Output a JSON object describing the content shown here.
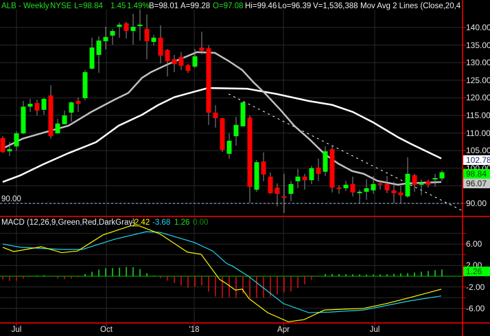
{
  "header": {
    "symbol": "ALB - Weekly",
    "exchange": "NYSE",
    "last": "L=98.84",
    "change": "1.45",
    "change_pct": "1.49%",
    "bid": "B=98.01",
    "ask": "A=99.28",
    "open": "O=97.08",
    "high": "Hi=99.46",
    "low": "Lo=96.39",
    "volume": "V=1,536,388",
    "study": "Mov Avg 2 Lines (Close,20,4 ..."
  },
  "macd_header": {
    "label": "MACD (12,26,9,Green,Red,DarkGray)",
    "macd": "-2.42",
    "signal": "-3.68",
    "histogram": "1.26",
    "zero": "0.00"
  },
  "price_axis": [
    "140.00",
    "135.00",
    "130.00",
    "125.00",
    "120.00",
    "115.00",
    "110.00",
    "105.00",
    "100.00",
    "90.00"
  ],
  "price_tags": {
    "ma40": "102.78",
    "last": "98.84",
    "ma20": "96.07"
  },
  "support_label": "90.00",
  "macd_axis": [
    "6.00",
    "2.00",
    "-2.00",
    "-6.00"
  ],
  "macd_tag": "1.26",
  "x_labels": [
    "Jul",
    "Oct",
    "'18",
    "Apr",
    "Jul"
  ],
  "colors": {
    "up": "#00ff00",
    "down": "#ff0000",
    "ma20": "#c0c0c0",
    "ma40": "#ffffff",
    "macd": "#ffff00",
    "signal": "#20d8f0",
    "axis": "#ff0000",
    "grid": "#2a2a2a",
    "support": "#9ec9ff"
  },
  "chart_data": {
    "type": "candlestick",
    "title": "ALB - Weekly",
    "ylim": [
      85,
      145
    ],
    "x_tick_labels": [
      {
        "label": "Jul",
        "index": 2
      },
      {
        "label": "Oct",
        "index": 15.1
      },
      {
        "label": "'18",
        "index": 27.9
      },
      {
        "label": "Apr",
        "index": 40.9
      },
      {
        "label": "Jul",
        "index": 54.2
      }
    ],
    "candles_ohlc": [
      [
        108.6,
        109.1,
        104.3,
        104.6
      ],
      [
        104.8,
        107.4,
        103.5,
        105.4
      ],
      [
        106.2,
        110.5,
        105.0,
        109.9
      ],
      [
        109.9,
        119.1,
        109.7,
        117.5
      ],
      [
        117.5,
        119.7,
        116.0,
        118.3
      ],
      [
        118.5,
        119.5,
        115.0,
        116.4
      ],
      [
        116.6,
        120.1,
        115.2,
        119.7
      ],
      [
        120.7,
        123.6,
        108.4,
        109.1
      ],
      [
        109.9,
        114.0,
        109.9,
        112.7
      ],
      [
        112.5,
        116.4,
        112.5,
        115.0
      ],
      [
        115.8,
        118.9,
        113.2,
        118.7
      ],
      [
        119.1,
        120.1,
        116.0,
        118.3
      ],
      [
        119.9,
        127.9,
        119.3,
        127.3
      ],
      [
        128.3,
        137.1,
        128.1,
        134.3
      ],
      [
        132.2,
        137.5,
        127.1,
        136.3
      ],
      [
        136.1,
        140.2,
        133.8,
        137.3
      ],
      [
        137.7,
        139.6,
        135.1,
        139.0
      ],
      [
        140.2,
        141.4,
        137.1,
        140.8
      ],
      [
        141.2,
        141.6,
        136.9,
        139.0
      ],
      [
        139.0,
        143.9,
        135.1,
        140.2
      ],
      [
        140.4,
        145.1,
        136.3,
        140.8
      ],
      [
        139.6,
        143.7,
        131.0,
        136.1
      ],
      [
        135.9,
        137.9,
        134.9,
        137.1
      ],
      [
        137.1,
        140.6,
        129.8,
        132.0
      ],
      [
        133.6,
        133.9,
        126.1,
        130.4
      ],
      [
        131.0,
        132.2,
        127.3,
        129.6
      ],
      [
        131.6,
        133.0,
        127.9,
        129.1
      ],
      [
        129.3,
        129.6,
        127.1,
        127.7
      ],
      [
        128.9,
        133.9,
        128.5,
        131.8
      ],
      [
        134.3,
        138.8,
        132.4,
        133.4
      ],
      [
        134.1,
        134.9,
        112.3,
        115.8
      ],
      [
        115.8,
        117.9,
        111.5,
        114.2
      ],
      [
        114.2,
        114.4,
        104.6,
        105.2
      ],
      [
        104.1,
        109.9,
        102.7,
        107.8
      ],
      [
        109.1,
        114.6,
        106.4,
        112.3
      ],
      [
        111.9,
        118.9,
        111.9,
        118.7
      ],
      [
        114.4,
        115.0,
        90.2,
        94.7
      ],
      [
        93.9,
        102.3,
        93.3,
        101.7
      ],
      [
        101.9,
        104.5,
        96.3,
        98.2
      ],
      [
        97.6,
        98.8,
        92.7,
        92.9
      ],
      [
        94.5,
        95.7,
        89.2,
        92.7
      ],
      [
        92.0,
        98.4,
        87.3,
        91.6
      ],
      [
        92.7,
        96.4,
        90.6,
        95.5
      ],
      [
        96.3,
        99.8,
        94.3,
        97.6
      ],
      [
        97.6,
        98.4,
        93.9,
        96.6
      ],
      [
        96.6,
        100.7,
        95.5,
        100.0
      ],
      [
        100.2,
        102.7,
        96.4,
        98.4
      ],
      [
        99.0,
        106.2,
        97.8,
        104.8
      ],
      [
        105.4,
        106.4,
        93.1,
        94.5
      ],
      [
        94.5,
        95.1,
        92.7,
        94.1
      ],
      [
        94.3,
        96.4,
        93.5,
        95.3
      ],
      [
        95.5,
        97.6,
        92.0,
        93.1
      ],
      [
        92.9,
        93.9,
        90.0,
        93.3
      ],
      [
        93.3,
        96.8,
        91.0,
        94.3
      ],
      [
        93.7,
        97.8,
        92.7,
        95.5
      ],
      [
        95.7,
        96.6,
        93.9,
        95.3
      ],
      [
        95.5,
        97.8,
        92.9,
        93.7
      ],
      [
        93.7,
        96.1,
        90.0,
        92.9
      ],
      [
        93.1,
        94.9,
        90.0,
        92.3
      ],
      [
        92.0,
        103.1,
        91.6,
        98.4
      ],
      [
        98.0,
        98.4,
        93.3,
        95.3
      ],
      [
        95.3,
        96.8,
        92.3,
        95.9
      ],
      [
        96.3,
        96.8,
        94.5,
        95.3
      ],
      [
        96.8,
        98.4,
        94.7,
        97.2
      ],
      [
        97.08,
        99.46,
        96.39,
        98.84
      ]
    ],
    "ma20_points": [
      [
        0,
        105.6
      ],
      [
        2.9,
        108.4
      ],
      [
        6.3,
        110.3
      ],
      [
        9.6,
        112.1
      ],
      [
        12.9,
        116.0
      ],
      [
        16.3,
        119.5
      ],
      [
        18.3,
        121.4
      ],
      [
        20.3,
        125.7
      ],
      [
        21.6,
        127.3
      ],
      [
        24,
        129.5
      ],
      [
        28.3,
        133.0
      ],
      [
        30.9,
        132.8
      ],
      [
        32.9,
        130.5
      ],
      [
        34.9,
        127.9
      ],
      [
        36.5,
        124.5
      ],
      [
        38.3,
        121.1
      ],
      [
        40.5,
        116.5
      ],
      [
        42.5,
        112.0
      ],
      [
        44.6,
        108.4
      ],
      [
        46.9,
        104.0
      ],
      [
        48.9,
        101.3
      ],
      [
        50.9,
        99.2
      ],
      [
        52.6,
        98.4
      ],
      [
        54.6,
        96.4
      ],
      [
        57.6,
        95.3
      ],
      [
        58.9,
        95.7
      ],
      [
        63.9,
        96.07
      ]
    ],
    "ma40_points": [
      [
        0,
        96.1
      ],
      [
        2.6,
        98.0
      ],
      [
        5.9,
        101.1
      ],
      [
        9.6,
        104.3
      ],
      [
        13.6,
        107.4
      ],
      [
        16.9,
        112.1
      ],
      [
        20.3,
        115.2
      ],
      [
        22.6,
        117.9
      ],
      [
        25,
        120.2
      ],
      [
        29.9,
        122.8
      ],
      [
        35.6,
        122.6
      ],
      [
        39.9,
        121.1
      ],
      [
        44.6,
        119.1
      ],
      [
        48,
        118.0
      ],
      [
        51,
        116.0
      ],
      [
        54,
        113.0
      ],
      [
        57.6,
        108.8
      ],
      [
        59.6,
        106.8
      ],
      [
        63.9,
        102.78
      ]
    ],
    "trendline": [
      [
        32.9,
        121.1
      ],
      [
        67,
        87.9
      ]
    ],
    "support_level": 90,
    "macd": {
      "ylim": [
        -9,
        10
      ],
      "macd_points": [
        [
          0,
          5.4
        ],
        [
          1.6,
          4.6
        ],
        [
          5.6,
          5.5
        ],
        [
          8.6,
          4.4
        ],
        [
          10.9,
          4.7
        ],
        [
          14.6,
          7.7
        ],
        [
          18.6,
          9.4
        ],
        [
          19.9,
          9.4
        ],
        [
          22.9,
          7.9
        ],
        [
          26.9,
          4.5
        ],
        [
          28.9,
          4.1
        ],
        [
          31.6,
          -0.6
        ],
        [
          32.6,
          -1.4
        ],
        [
          33.9,
          -2.6
        ],
        [
          34.9,
          -2.4
        ],
        [
          35.9,
          -4.2
        ],
        [
          38.6,
          -6.8
        ],
        [
          41.6,
          -8.5
        ],
        [
          43.9,
          -8.1
        ],
        [
          46.9,
          -6.3
        ],
        [
          52.6,
          -6.0
        ],
        [
          55.9,
          -5.1
        ],
        [
          59.3,
          -4.0
        ],
        [
          63.9,
          -2.42
        ]
      ],
      "signal_points": [
        [
          0,
          6.0
        ],
        [
          2.6,
          5.4
        ],
        [
          8.6,
          5.0
        ],
        [
          11.6,
          5.0
        ],
        [
          16.3,
          6.9
        ],
        [
          20.9,
          8.3
        ],
        [
          22.9,
          8.2
        ],
        [
          27.9,
          6.3
        ],
        [
          30.6,
          4.7
        ],
        [
          32.6,
          2.4
        ],
        [
          33.6,
          1.8
        ],
        [
          35.9,
          -0.1
        ],
        [
          40.9,
          -5.1
        ],
        [
          44.6,
          -6.8
        ],
        [
          47.6,
          -6.7
        ],
        [
          52.6,
          -6.3
        ],
        [
          59.3,
          -4.6
        ],
        [
          63.9,
          -3.68
        ]
      ]
    }
  }
}
